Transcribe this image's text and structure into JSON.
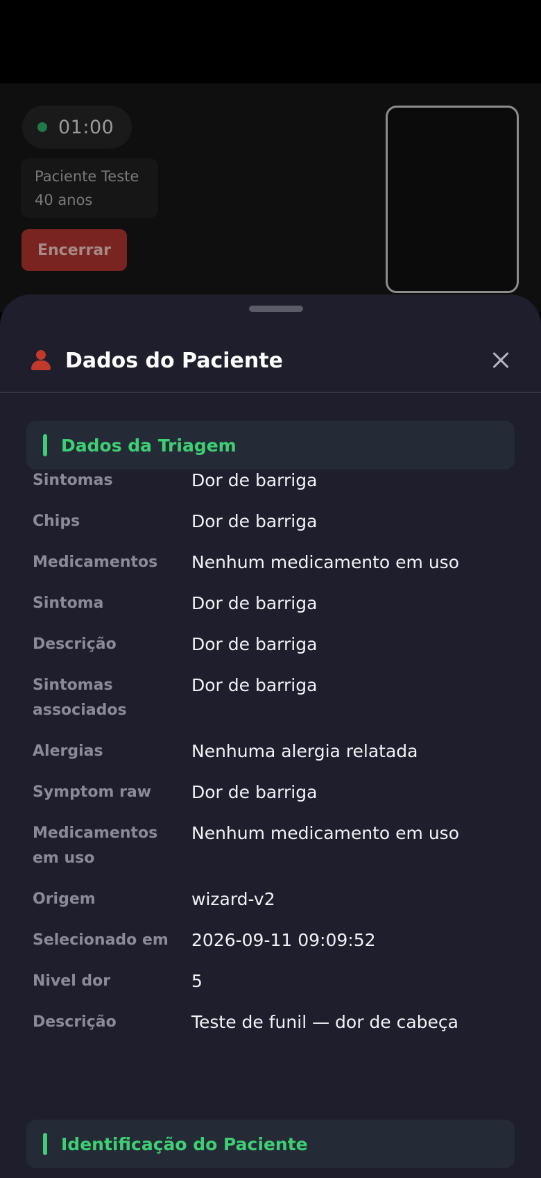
{
  "call": {
    "timer": "01:00",
    "patient_name": "Paciente Teste",
    "patient_age": "40 anos",
    "end_button_label": "Encerrar"
  },
  "sheet": {
    "title": "Dados do Paciente",
    "close_icon": "close-icon",
    "user_icon": "person-icon"
  },
  "triage": {
    "title": "Dados da Triagem",
    "rows": [
      {
        "label": "Sintomas",
        "value": "Dor de barriga"
      },
      {
        "label": "Chips",
        "value": "Dor de barriga"
      },
      {
        "label": "Medicamentos",
        "value": "Nenhum medicamento em uso"
      },
      {
        "label": "Sintoma",
        "value": "Dor de barriga"
      },
      {
        "label": "Descrição",
        "value": "Dor de barriga"
      },
      {
        "label": "Sintomas associados",
        "value": "Dor de barriga"
      },
      {
        "label": "Alergias",
        "value": "Nenhuma alergia relatada"
      },
      {
        "label": "Symptom raw",
        "value": "Dor de barriga"
      },
      {
        "label": "Medicamentos em uso",
        "value": "Nenhum medicamento em uso"
      },
      {
        "label": "Origem",
        "value": "wizard-v2"
      },
      {
        "label": "Selecionado em",
        "value": "2026-09-11 09:09:52"
      },
      {
        "label": "Nivel dor",
        "value": "5"
      },
      {
        "label": "Descrição",
        "value": "Teste de funil — dor de cabeça"
      }
    ]
  },
  "identification": {
    "title": "Identificação do Paciente"
  },
  "colors": {
    "accent_green": "#3ecf73",
    "danger_red": "#c0392b",
    "sheet_bg": "#1e1e2d"
  }
}
